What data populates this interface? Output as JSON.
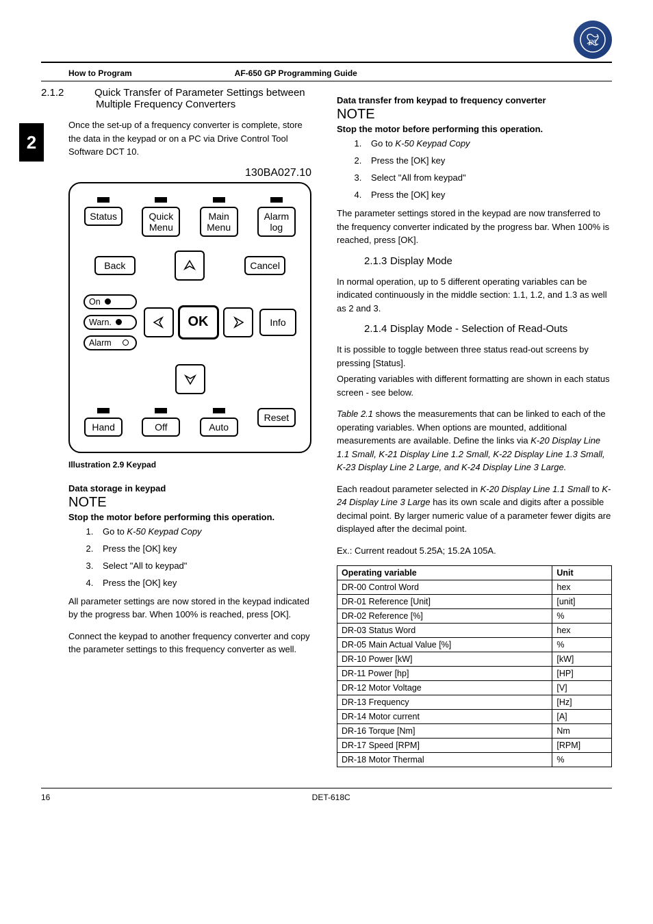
{
  "logo_name": "ge-logo",
  "header": {
    "left": "How to Program",
    "center": "AF-650 GP Programming Guide"
  },
  "side_tab": "2",
  "left_col": {
    "sec212": {
      "num": "2.1.2",
      "title": "Quick Transfer of Parameter Settings between Multiple Frequency Converters",
      "p1": "Once the set-up of a frequency converter is complete, store the data in the keypad or on a PC via Drive Control Tool Software DCT 10."
    },
    "figure": {
      "label": "130BA027.10",
      "buttons": {
        "status": "Status",
        "quick_menu": "Quick\nMenu",
        "main_menu": "Main\nMenu",
        "alarm_log": "Alarm\nlog",
        "back": "Back",
        "cancel": "Cancel",
        "ok": "OK",
        "info": "Info",
        "on": "On",
        "warn": "Warn.",
        "alarm": "Alarm",
        "hand": "Hand",
        "off": "Off",
        "auto": "Auto",
        "reset": "Reset"
      },
      "caption": "Illustration 2.9 Keypad"
    },
    "storage": {
      "heading": "Data storage in keypad",
      "note": "NOTE",
      "bold": "Stop the motor before performing this operation.",
      "steps": [
        "Go to K-50 Keypad Copy",
        "Press the [OK] key",
        "Select \"All to keypad\"",
        "Press the [OK] key"
      ],
      "p1": "All parameter settings are now stored in the keypad indicated by the progress bar. When 100% is reached, press [OK].",
      "p2": "Connect the keypad to another frequency converter and copy the parameter settings to this frequency converter as well."
    }
  },
  "right_col": {
    "transfer": {
      "heading": "Data transfer from keypad to frequency converter",
      "note": "NOTE",
      "bold": "Stop the motor before performing this operation.",
      "steps": [
        "Go to K-50 Keypad Copy",
        "Press the [OK] key",
        "Select \"All from keypad\"",
        "Press the [OK] key"
      ],
      "p1": "The parameter settings stored in the keypad are now transferred to the frequency converter indicated by the progress bar. When 100% is reached, press [OK]."
    },
    "sec213": {
      "num": "2.1.3",
      "title": "Display Mode",
      "p1": "In normal operation, up to 5 different operating variables can be indicated continuously in the middle section: 1.1, 1.2, and 1.3 as well as 2 and 3."
    },
    "sec214": {
      "num": "2.1.4",
      "title": "Display Mode - Selection of Read-Outs",
      "p1": "It is possible to toggle between three status read-out screens by pressing [Status].",
      "p2": "Operating variables with different formatting are shown in each status screen - see below.",
      "p3_pre": "Table 2.1",
      "p3": " shows the measurements that can be linked to each of the operating variables. When options are mounted, additional measurements are available. Define the links via ",
      "p3_links": "K-20 Display Line 1.1 Small, K-21 Display Line 1.2 Small, K-22 Display Line 1.3 Small, K-23 Display Line 2 Large, and K-24 Display Line 3 Large.",
      "p4_pre": "Each readout parameter selected in ",
      "p4_i1": "K-20 Display Line 1.1 Small",
      "p4_mid": " to ",
      "p4_i2": "K-24 Display Line 3 Large",
      "p4_post": " has its own scale and digits after a possible decimal point. By larger numeric value of a parameter fewer digits are displayed after the decimal point.",
      "p5": "Ex.: Current readout 5.25A; 15.2A 105A."
    },
    "table": {
      "h1": "Operating variable",
      "h2": "Unit",
      "rows": [
        [
          "DR-00 Control Word",
          "hex"
        ],
        [
          "DR-01 Reference [Unit]",
          "[unit]"
        ],
        [
          "DR-02 Reference [%]",
          "%"
        ],
        [
          "DR-03 Status Word",
          "hex"
        ],
        [
          "DR-05 Main Actual Value [%]",
          "%"
        ],
        [
          "DR-10 Power [kW]",
          "[kW]"
        ],
        [
          "DR-11 Power [hp]",
          "[HP]"
        ],
        [
          "DR-12 Motor Voltage",
          "[V]"
        ],
        [
          "DR-13 Frequency",
          "[Hz]"
        ],
        [
          "DR-14 Motor current",
          "[A]"
        ],
        [
          "DR-16 Torque [Nm]",
          "Nm"
        ],
        [
          "DR-17 Speed [RPM]",
          "[RPM]"
        ],
        [
          "DR-18 Motor Thermal",
          "%"
        ]
      ]
    }
  },
  "footer": {
    "page": "16",
    "doc": "DET-618C"
  }
}
